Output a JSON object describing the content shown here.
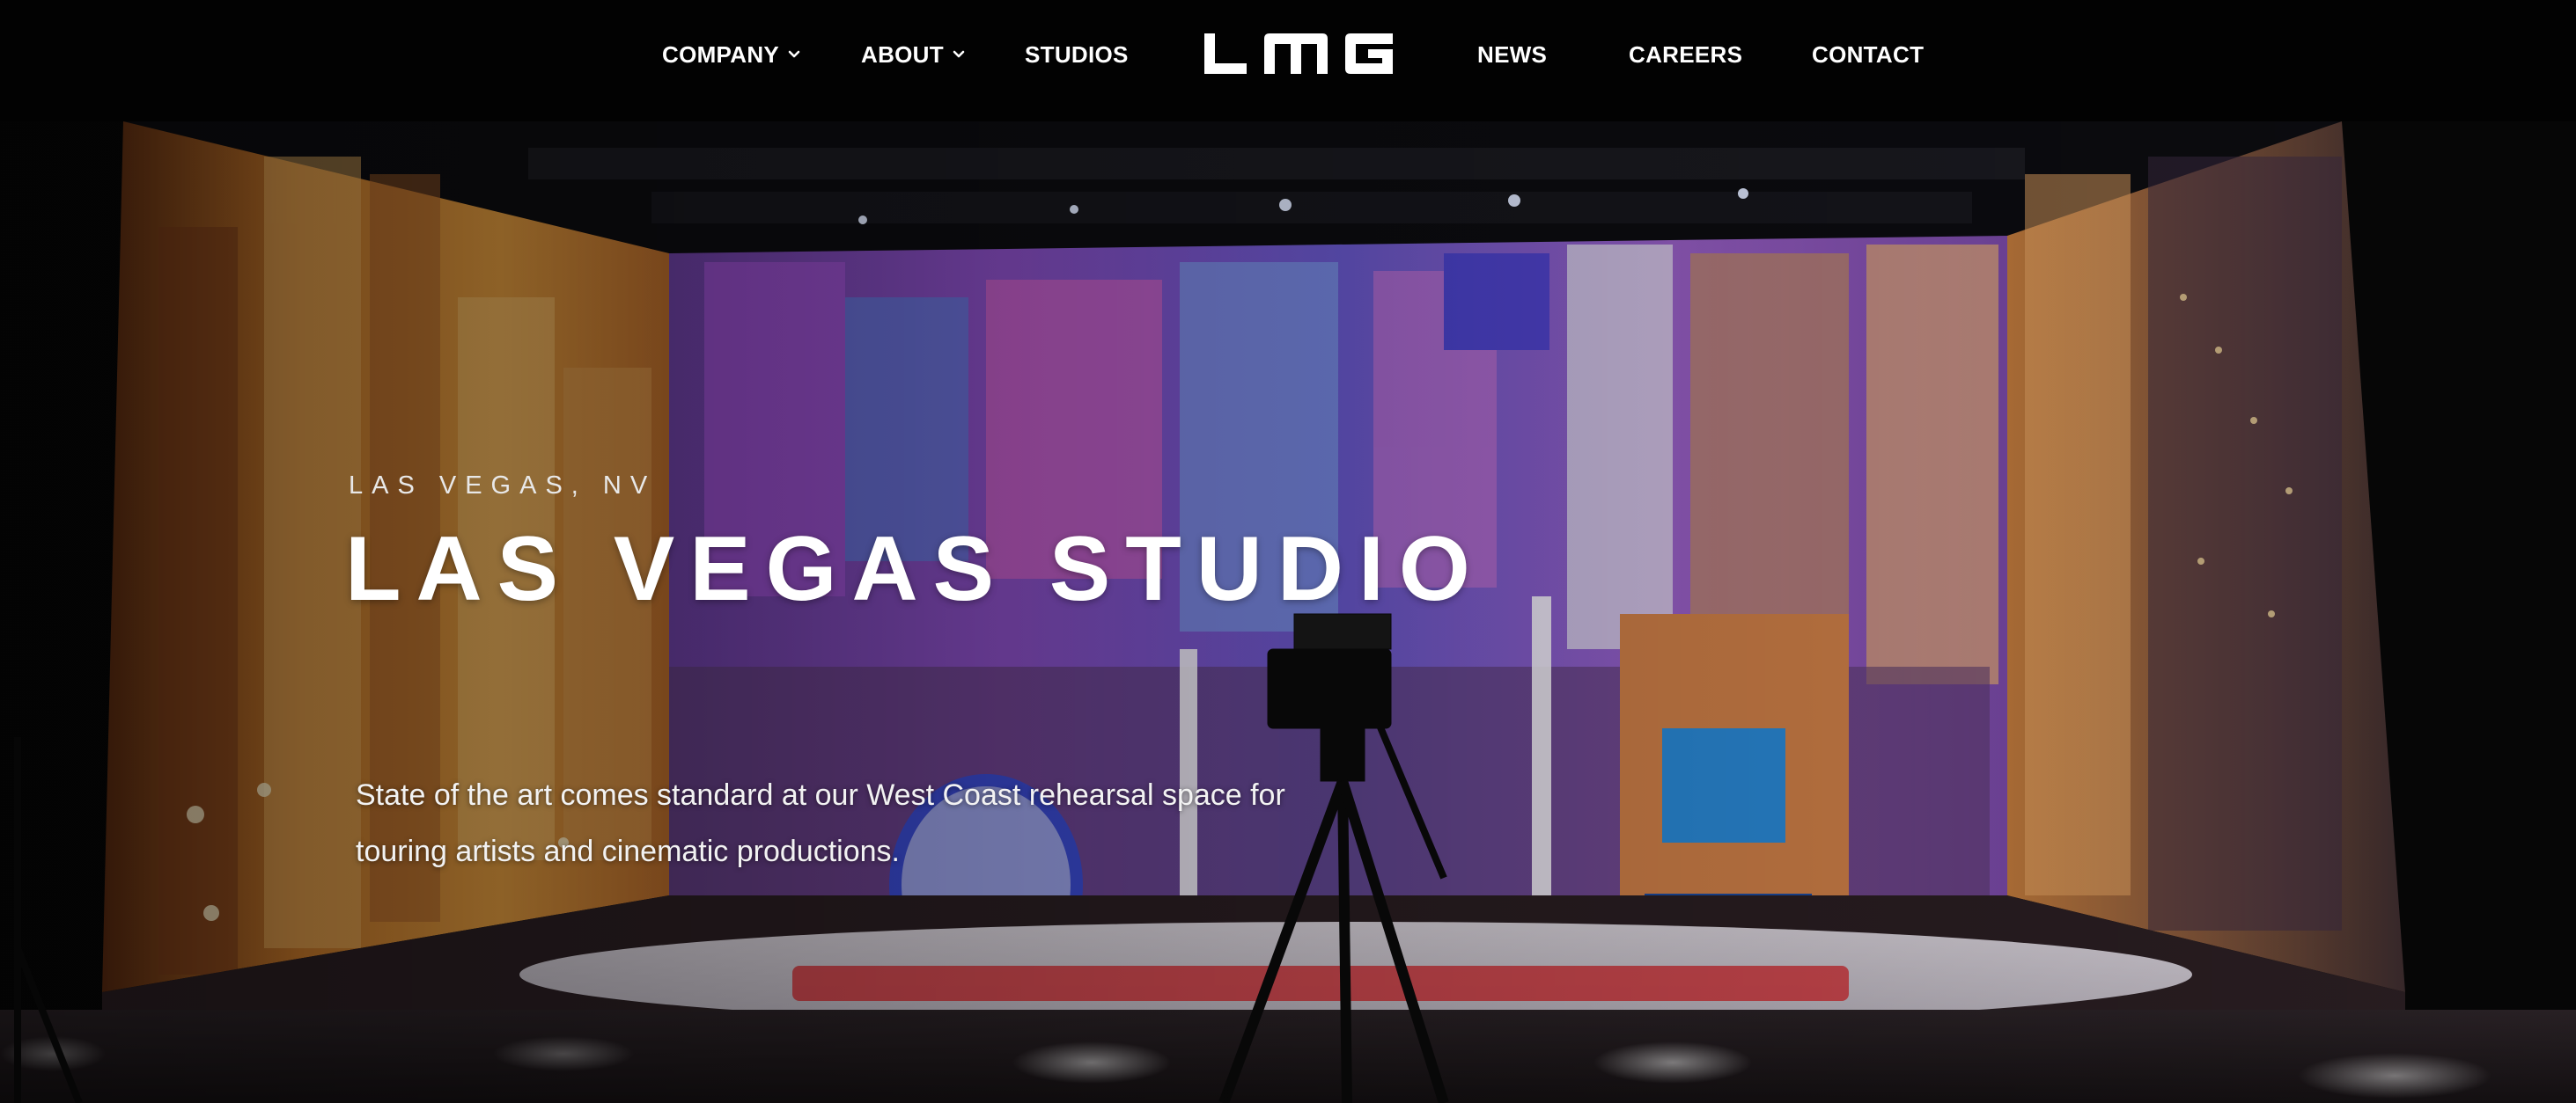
{
  "nav": {
    "left_items": [
      {
        "label": "COMPANY",
        "has_dropdown": true
      },
      {
        "label": "ABOUT",
        "has_dropdown": true
      },
      {
        "label": "STUDIOS",
        "has_dropdown": false
      }
    ],
    "logo_text": "LMG",
    "right_items": [
      {
        "label": "NEWS"
      },
      {
        "label": "CAREERS"
      },
      {
        "label": "CONTACT"
      }
    ],
    "icons": {
      "dropdown": "chevron-down-icon"
    }
  },
  "hero": {
    "eyebrow": "LAS VEGAS, NV",
    "title": "LAS VEGAS STUDIO",
    "description": "State of the art comes standard at our West Coast rehearsal space for touring artists and cinematic productions."
  },
  "colors": {
    "nav_background": "#020202",
    "text": "#ffffff",
    "page_background": "#030303"
  }
}
